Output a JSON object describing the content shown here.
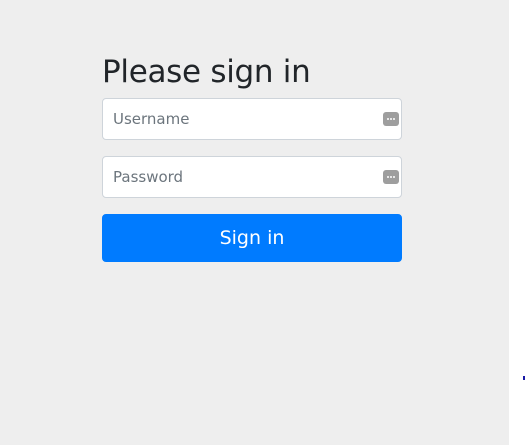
{
  "login": {
    "heading": "Please sign in",
    "username_placeholder": "Username",
    "username_value": "",
    "password_placeholder": "Password",
    "password_value": "",
    "submit_label": "Sign in"
  },
  "icons": {
    "username_field_icon": "password-manager-icon",
    "password_field_icon": "password-manager-icon"
  },
  "colors": {
    "accent": "#007bff",
    "page_background": "#eeeeee",
    "icon_gray": "#9e9e9e"
  }
}
